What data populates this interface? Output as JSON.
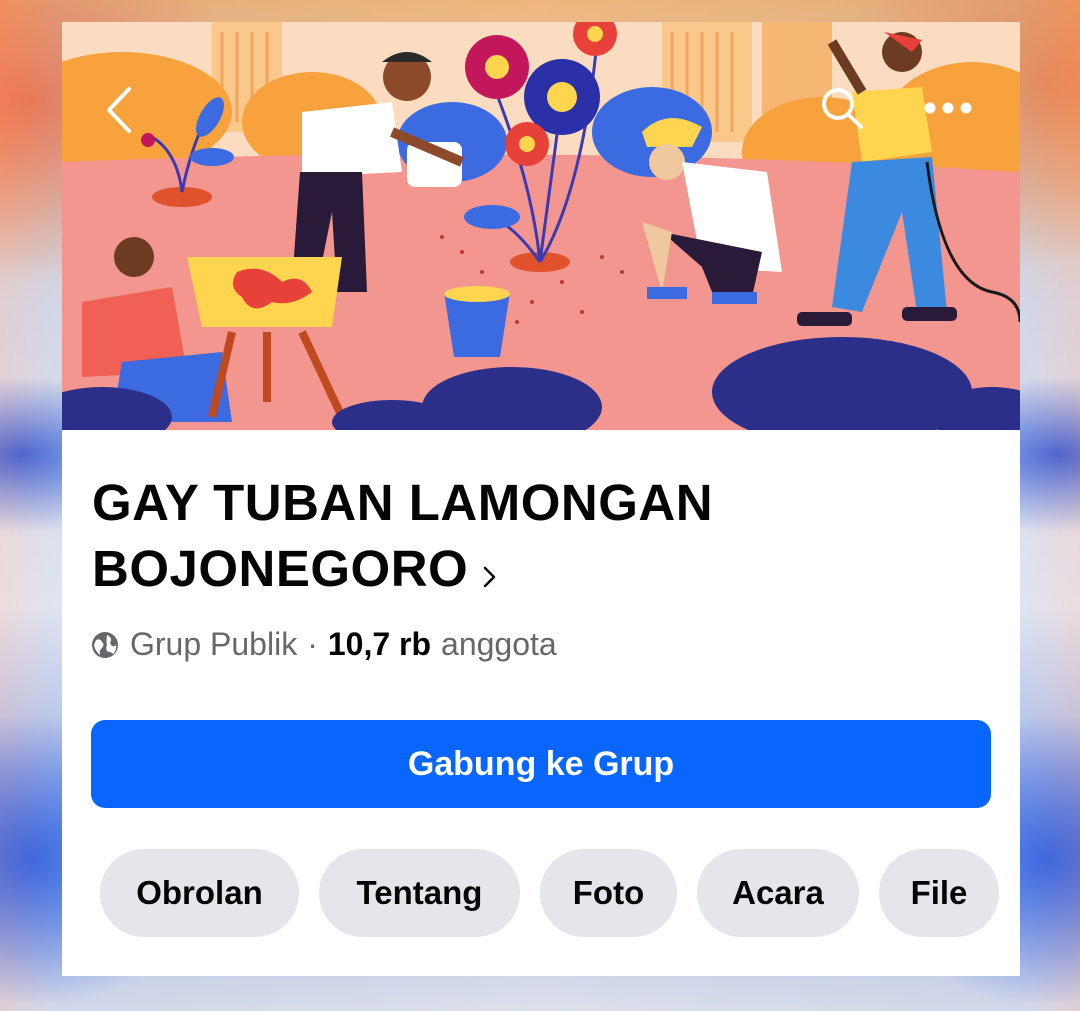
{
  "group": {
    "name": "GAY TUBAN LAMONGAN BOJONEGORO",
    "privacy": "Grup Publik",
    "separator": "·",
    "member_count": "10,7 rb",
    "member_label": "anggota"
  },
  "actions": {
    "join_label": "Gabung ke Grup"
  },
  "tabs": [
    {
      "label": "Obrolan"
    },
    {
      "label": "Tentang"
    },
    {
      "label": "Foto"
    },
    {
      "label": "Acara"
    },
    {
      "label": "File"
    }
  ],
  "icons": {
    "back": "chevron-left-icon",
    "search": "search-icon",
    "more": "more-icon",
    "title_chevron": "chevron-right-icon",
    "privacy": "globe-icon"
  },
  "colors": {
    "primary": "#0866ff",
    "tab_bg": "#e4e6eb",
    "text_primary": "#050505",
    "text_secondary": "#65676b"
  }
}
